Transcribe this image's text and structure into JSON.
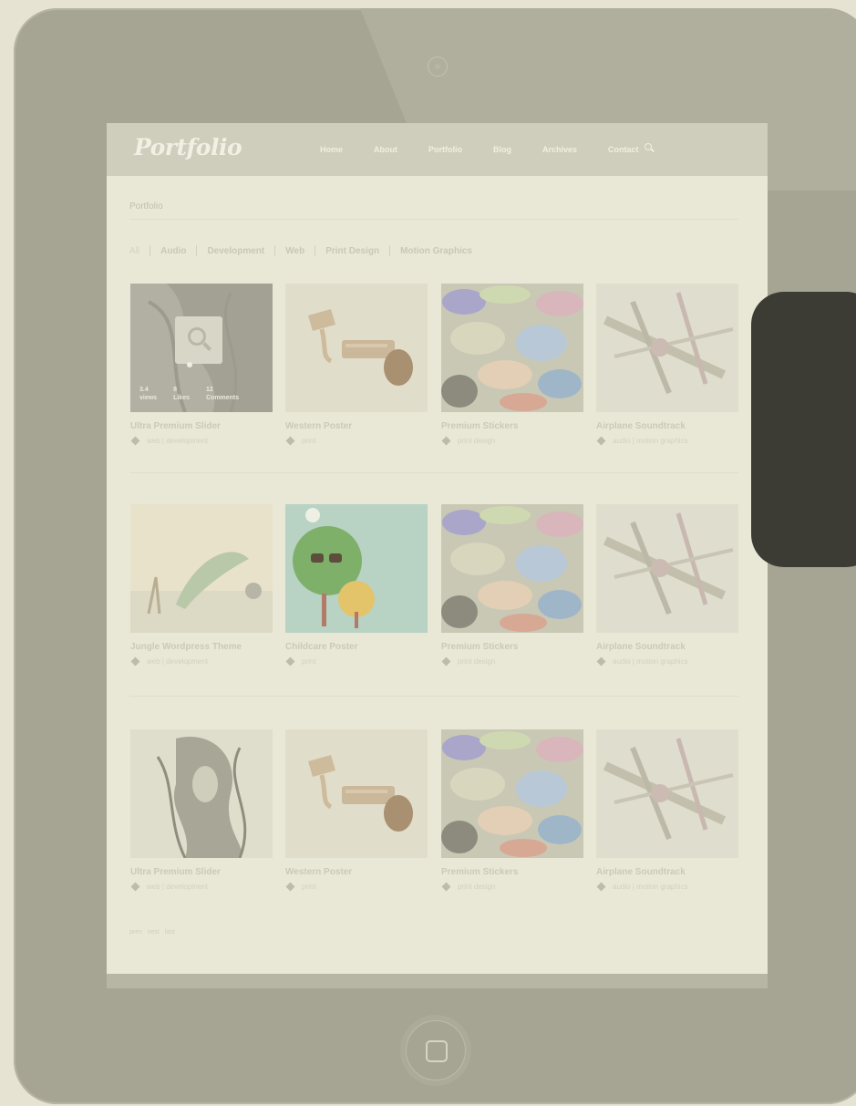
{
  "site": {
    "logo": "Portfolio",
    "nav": [
      "Home",
      "About",
      "Portfolio",
      "Blog",
      "Archives",
      "Contact"
    ]
  },
  "page_title": "Portfolio",
  "filters": [
    "All",
    "Audio",
    "Development",
    "Web",
    "Print Design",
    "Motion Graphics"
  ],
  "hover_stats": [
    {
      "value": "3.4",
      "label": "views"
    },
    {
      "value": "8",
      "label": "Likes"
    },
    {
      "value": "12",
      "label": "Comments"
    }
  ],
  "items": [
    {
      "title": "Ultra Premium Slider",
      "tags": "web | development"
    },
    {
      "title": "Western Poster",
      "tags": "print"
    },
    {
      "title": "Premium Stickers",
      "tags": "print design"
    },
    {
      "title": "Airplane Soundtrack",
      "tags": "audio | motion graphics"
    },
    {
      "title": "Jungle Wordpress Theme",
      "tags": "web | development"
    },
    {
      "title": "Childcare Poster",
      "tags": "print"
    },
    {
      "title": "Premium Stickers",
      "tags": "print design"
    },
    {
      "title": "Airplane Soundtrack",
      "tags": "audio | motion graphics"
    },
    {
      "title": "Ultra Premium Slider",
      "tags": "web | development"
    },
    {
      "title": "Western Poster",
      "tags": "print"
    },
    {
      "title": "Premium Stickers",
      "tags": "print design"
    },
    {
      "title": "Airplane Soundtrack",
      "tags": "audio | motion graphics"
    }
  ],
  "pagination": [
    "prev",
    "next",
    "last"
  ],
  "colors": {
    "tablet_frame": "#a6a493",
    "screen_bg": "#e9e7d6",
    "side_panel": "#3c3b34"
  }
}
